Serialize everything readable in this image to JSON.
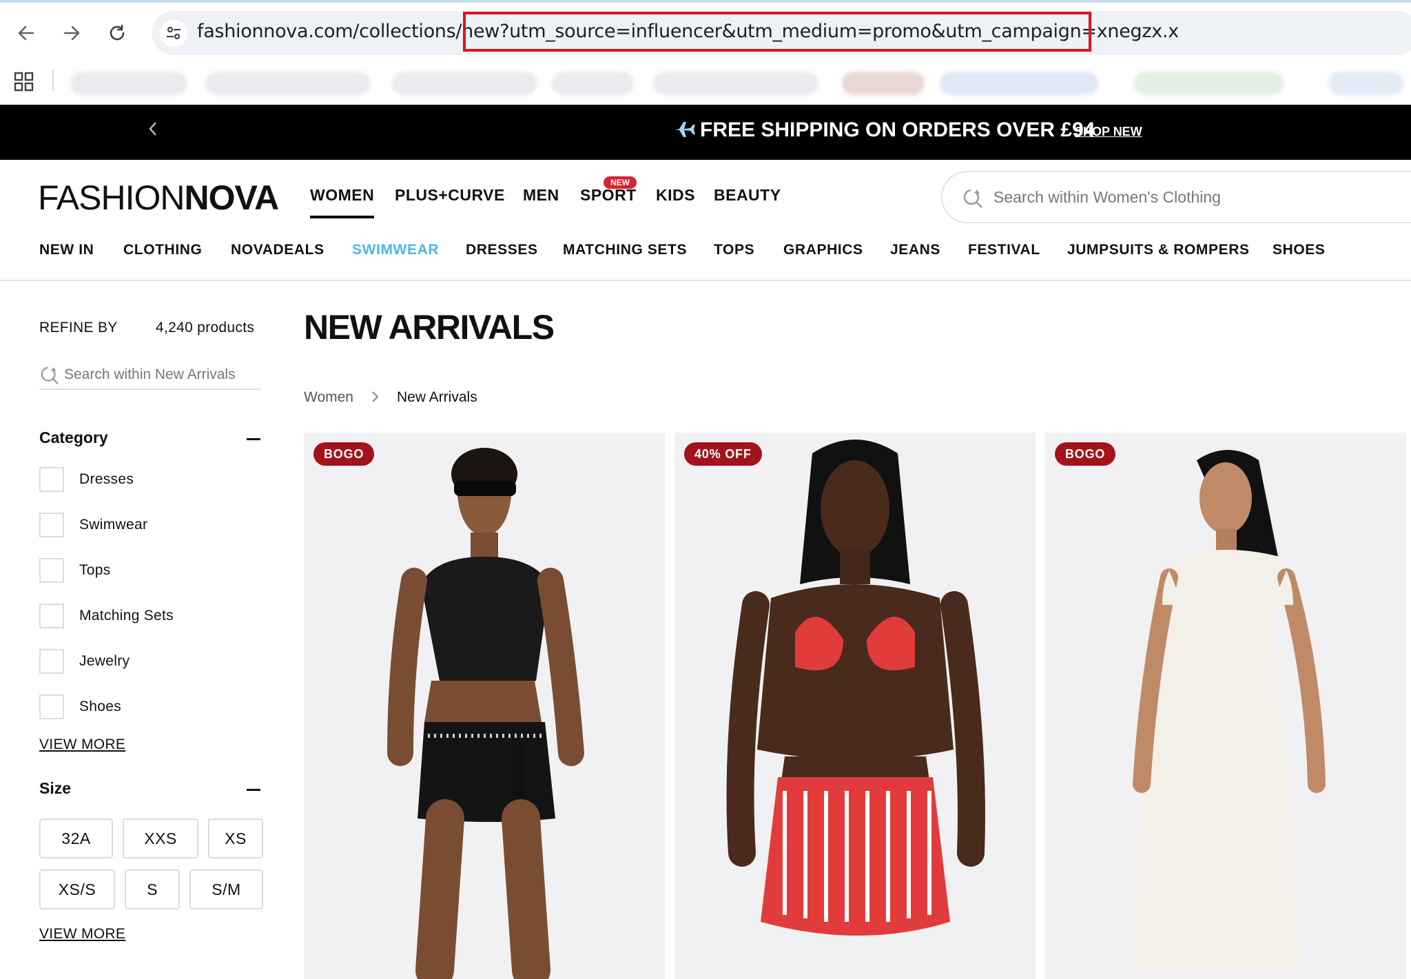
{
  "browser": {
    "url": "fashionnova.com/collections/new?utm_source=influencer&utm_medium=promo&utm_campaign=xnegzx.x",
    "url_highlight_color": "#e0131a"
  },
  "promo": {
    "text": "FREE SHIPPING ON ORDERS OVER £94",
    "link": "SHOP NEW",
    "icon": "airplane-icon"
  },
  "header": {
    "logo_light": "FASHION",
    "logo_bold": "NOVA",
    "nav": [
      "WOMEN",
      "PLUS+CURVE",
      "MEN",
      "SPORT",
      "KIDS",
      "BEAUTY"
    ],
    "new_badge": "NEW",
    "search_placeholder": "Search within Women's Clothing"
  },
  "subnav": [
    "NEW IN",
    "CLOTHING",
    "NOVADEALS",
    "SWIMWEAR",
    "DRESSES",
    "MATCHING SETS",
    "TOPS",
    "GRAPHICS",
    "JEANS",
    "FESTIVAL",
    "JUMPSUITS & ROMPERS",
    "SHOES"
  ],
  "subnav_active": "SWIMWEAR",
  "sidebar": {
    "refine_label": "REFINE BY",
    "product_count": "4,240 products",
    "search_placeholder": "Search within New Arrivals",
    "category_title": "Category",
    "categories": [
      "Dresses",
      "Swimwear",
      "Tops",
      "Matching Sets",
      "Jewelry",
      "Shoes"
    ],
    "view_more": "VIEW MORE",
    "size_title": "Size",
    "sizes": [
      "32A",
      "XXS",
      "XS",
      "XS/S",
      "S",
      "S/M"
    ]
  },
  "main": {
    "title": "NEW ARRIVALS",
    "breadcrumb": [
      "Women",
      "New Arrivals"
    ],
    "products": [
      {
        "badge": "BOGO"
      },
      {
        "badge": "40% OFF"
      },
      {
        "badge": "BOGO"
      }
    ]
  },
  "colors": {
    "accent_link": "#52b6e8",
    "badge_bg": "#a3131c",
    "promo_bg": "#000000"
  }
}
